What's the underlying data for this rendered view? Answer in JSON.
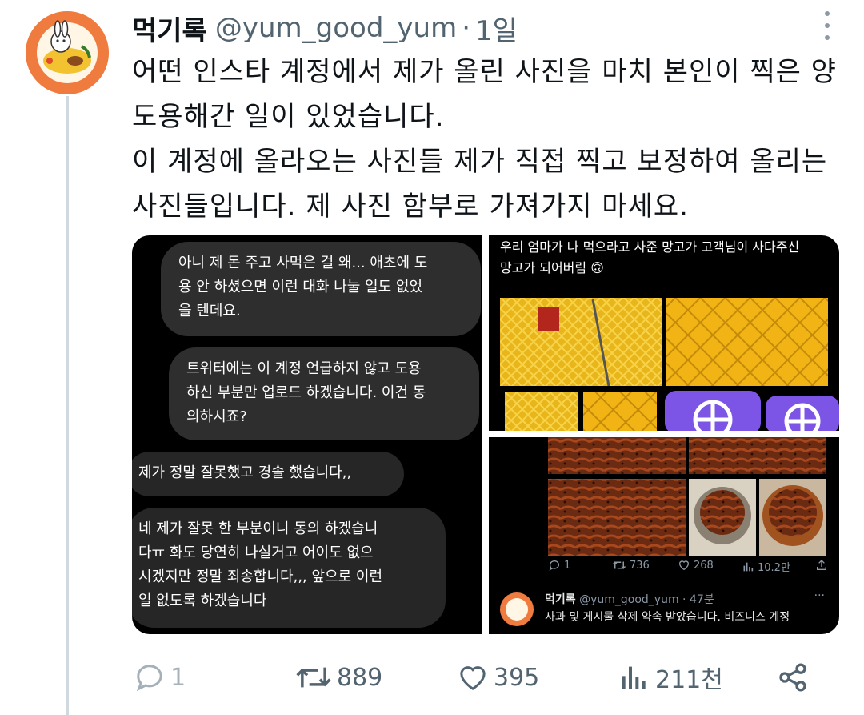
{
  "tweet": {
    "author_name": "먹기록",
    "handle": "@yum_good_yum",
    "separator": "·",
    "time": "1일",
    "lines": [
      "어떤 인스타 계정에서 제가 올린 사진을 마치 본인이 찍은 양",
      "도용해간 일이 있었습니다.",
      "이 계정에 올라오는 사진들 제가 직접 찍고 보정하여 올리는",
      "사진들입니다. 제 사진 함부로 가져가지 마세요."
    ]
  },
  "chat": {
    "bubbles": [
      [
        "아니 제 돈 주고 사먹은 걸 왜... 애초에 도",
        "용 안 하셨으면 이런 대화 나눌 일도 없었",
        "을 텐데요."
      ],
      [
        "트위터에는 이 계정 언급하지 않고 도용",
        "하신 부분만 업로드 하겠습니다. 이건 동",
        "의하시죠?"
      ],
      [
        "제가 정말 잘못했고 경솔 했습니다,,"
      ],
      [
        "네 제가 잘못 한 부분이니 동의 하겠습니",
        "다ㅠ 화도 당연히 나실거고 어이도 없으",
        "시겠지만 정말 죄송합니다,,, 앞으로 이런",
        "일 없도록 하겠습니다"
      ]
    ]
  },
  "mango_post": {
    "caption": [
      "우리 엄마가 나 먹으라고 사준 망고가 고객님이 사다주신",
      "망고가 되어버림 🙃"
    ]
  },
  "embedded_post": {
    "stats": {
      "replies": "1",
      "retweets": "736",
      "likes": "268",
      "views": "10.2만"
    },
    "reply_author": "먹기록",
    "reply_handle": "@yum_good_yum",
    "reply_time": "· 47분",
    "reply_text": "사과 및 게시물 삭제 약속 받았습니다. 비즈니스 계정"
  },
  "actions": {
    "replies": "1",
    "retweets": "889",
    "likes": "395",
    "views": "211천"
  },
  "colors": {
    "accent": "#f07b3f",
    "muted": "#536471",
    "thread_line": "#cfd9de"
  }
}
